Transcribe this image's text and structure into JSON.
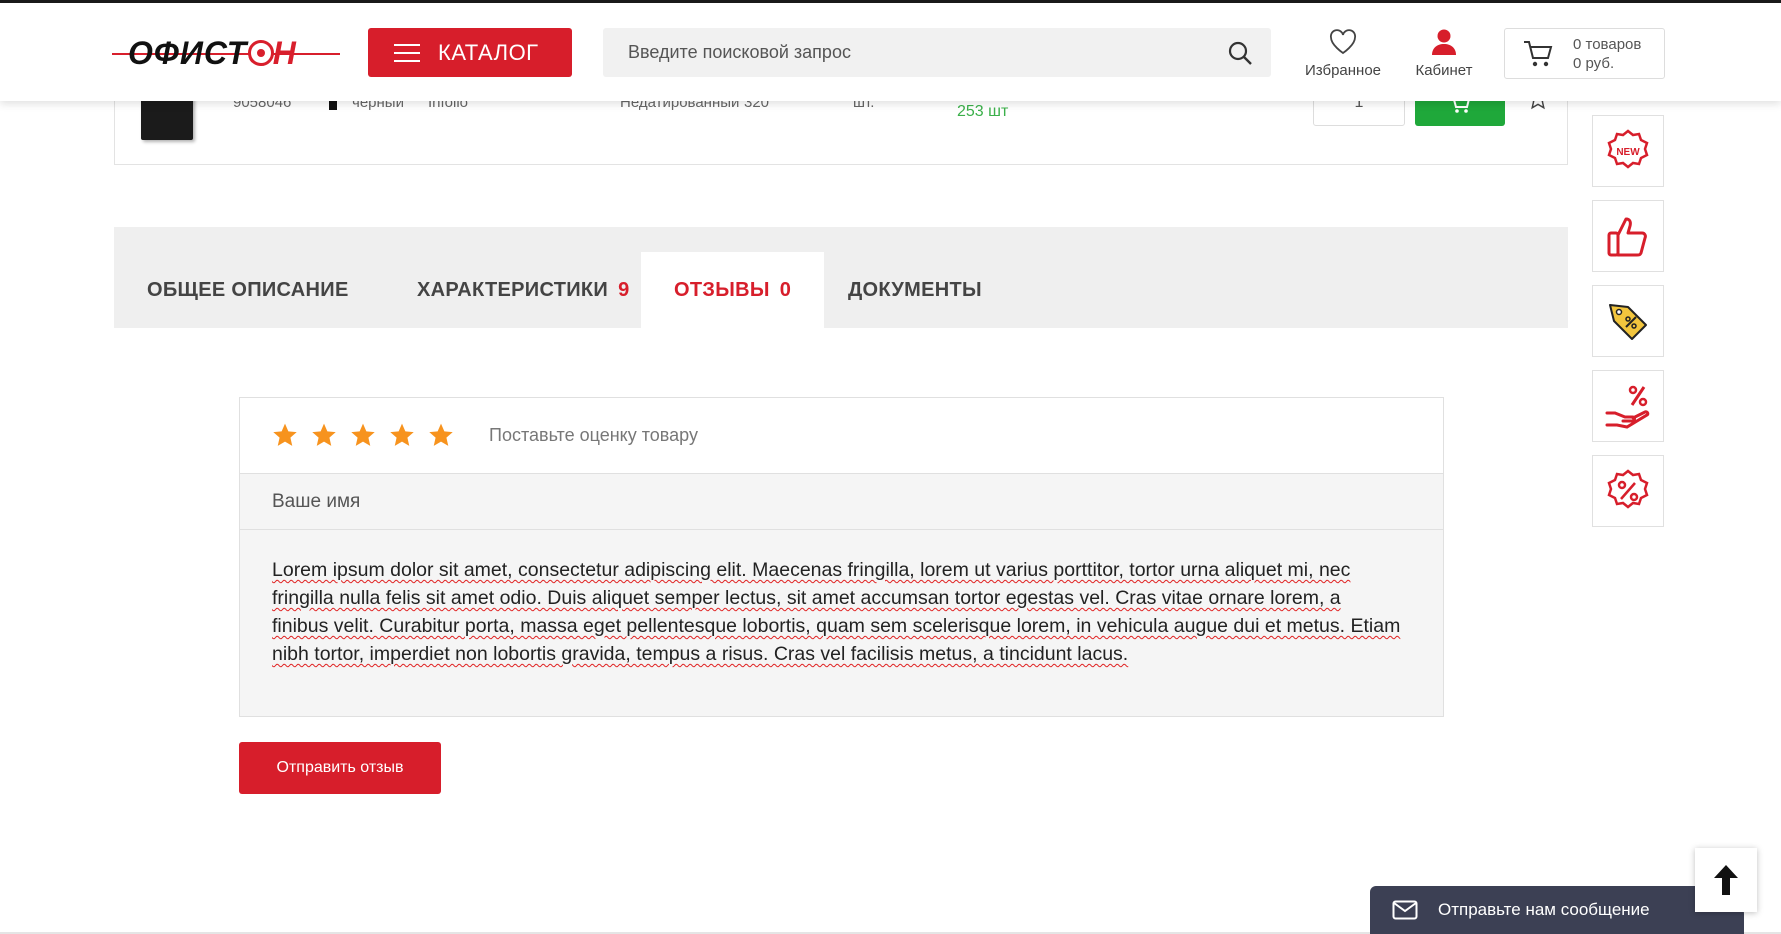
{
  "header": {
    "logo_text_dark": "ОФИСТ",
    "logo_text_red": "ОН",
    "catalog_label": "КАТАЛОГ",
    "search_placeholder": "Введите поисковой запрос",
    "favorites_label": "Избранное",
    "cabinet_label": "Кабинет",
    "cart_count": "0 товаров",
    "cart_sum": "0 руб."
  },
  "product_row": {
    "code": "9058046",
    "color": "черный",
    "brand": "Infolio",
    "type": "Недатированный",
    "pages": "320",
    "unit": "шт.",
    "stock": "253 шт",
    "quantity": "1"
  },
  "sidebar": {
    "icons": [
      "new-badge-icon",
      "thumbs-up-icon",
      "discount-tag-icon",
      "percent-hand-icon",
      "percent-badge-icon"
    ]
  },
  "tabs": [
    {
      "label": "ОБЩЕЕ ОПИСАНИЕ",
      "count": ""
    },
    {
      "label": "ХАРАКТЕРИСТИКИ",
      "count": "9"
    },
    {
      "label": "ОТЗЫВЫ",
      "count": "0",
      "active": true
    },
    {
      "label": "ДОКУМЕНТЫ",
      "count": ""
    }
  ],
  "review_form": {
    "rating_value": 5,
    "rating_max": 5,
    "rating_hint": "Поставьте оценку товару",
    "name_placeholder": "Ваше имя",
    "review_text": "Lorem ipsum dolor sit amet, consectetur adipiscing elit. Maecenas fringilla, lorem ut varius porttitor, tortor urna aliquet mi, nec fringilla nulla felis sit amet odio. Duis aliquet semper lectus, sit amet accumsan tortor egestas vel. Cras vitae ornare lorem, a finibus velit. Curabitur porta, massa eget pellentesque lobortis, quam sem scelerisque lorem, in vehicula augue dui et metus. Etiam nibh tortor, imperdiet non lobortis gravida, tempus a risus. Cras vel facilisis metus, a tincidunt lacus.",
    "submit_label": "Отправить отзыв"
  },
  "chat": {
    "label": "Отправьте нам сообщение"
  },
  "colors": {
    "accent": "#d71e2b",
    "star": "#f7931e",
    "cart_green": "#1fa83a",
    "chat_bg": "#3c4054"
  }
}
